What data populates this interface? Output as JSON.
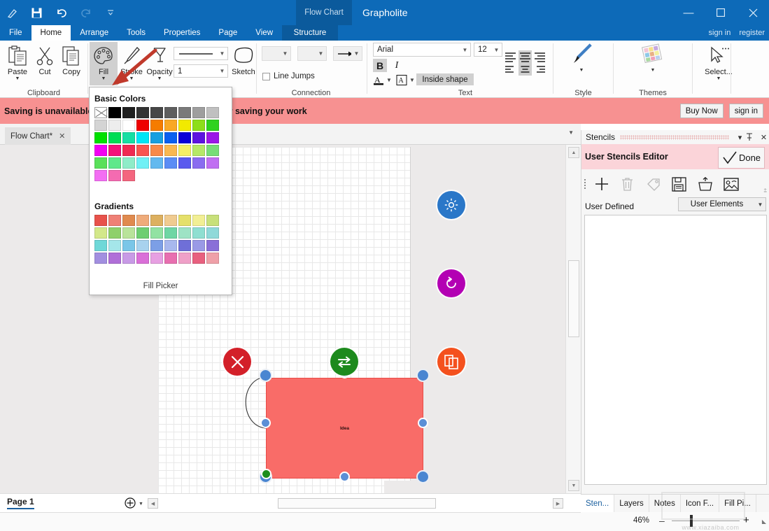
{
  "titlebar": {
    "app_title": "Grapholite",
    "context_tab": "Flow Chart",
    "quick_access": [
      {
        "name": "pen-icon",
        "glyph": "✎"
      },
      {
        "name": "save-icon",
        "glyph": "🖫"
      },
      {
        "name": "undo-icon",
        "glyph": "↶"
      },
      {
        "name": "redo-icon",
        "glyph": "↷"
      },
      {
        "name": "more-icon",
        "glyph": "⩔"
      }
    ],
    "window_controls": [
      {
        "name": "minimize-button",
        "glyph": "—"
      },
      {
        "name": "maximize-button",
        "glyph": "☐"
      },
      {
        "name": "close-button",
        "glyph": "✕"
      }
    ]
  },
  "ribbon_tabs": {
    "items": [
      "File",
      "Home",
      "Arrange",
      "Tools",
      "Properties",
      "Page",
      "View"
    ],
    "active": "Home",
    "context": "Structure",
    "sign_in": "sign in",
    "register": "register"
  },
  "ribbon": {
    "clipboard": {
      "group_label": "Clipboard",
      "paste": "Paste",
      "cut": "Cut",
      "copy": "Copy"
    },
    "style_tools": {
      "fill": "Fill",
      "stroke": "Stroke",
      "opacity": "Opacity",
      "sketch": "Sketch",
      "line_style_value": "",
      "line_width_value": "1"
    },
    "connection": {
      "group_label": "Connection",
      "line_jumps": "Line Jumps",
      "start_arrow_value": "",
      "mid_value": "",
      "end_arrow_value": "→"
    },
    "text": {
      "group_label": "Text",
      "font_family": "Arial",
      "font_size": "12",
      "bold": "B",
      "italic": "I",
      "font_color": "A",
      "highlight_color": "A",
      "text_position": "Inside shape"
    },
    "style": {
      "group_label": "Style"
    },
    "themes": {
      "group_label": "Themes"
    },
    "select": {
      "label": "Select..."
    }
  },
  "warning": {
    "message": "Saving is unavailable in trial version. Install full app for saving your work",
    "buy_now": "Buy Now",
    "sign_in": "sign in"
  },
  "doc_tabs": {
    "items": [
      {
        "label": "Flow Chart*",
        "close": "✕"
      }
    ]
  },
  "fill_panel": {
    "basic_colors_label": "Basic Colors",
    "gradients_label": "Gradients",
    "fill_picker_label": "Fill Picker",
    "basic_colors": [
      [
        "none",
        "#000000",
        "#1f1f1f",
        "#333333",
        "#474747",
        "#5e5e5e",
        "#7a7a7a",
        "#9e9e9e",
        "#c0c0c0"
      ],
      [
        "#d4d4d4",
        "#ededed",
        "#ffffff",
        "#ee0000",
        "#f57c00",
        "#f9a825",
        "#f2ea00",
        "#8ede1a",
        "#2fd21f"
      ],
      [
        "#00e000",
        "#00dd55",
        "#16dfa3",
        "#00e5f5",
        "#189fe0",
        "#0a5ff0",
        "#0a00d8",
        "#5c14e0",
        "#9b17e8"
      ],
      [
        "#f200f2",
        "#f4127b",
        "#f02a52",
        "#f9544f",
        "#f78a4a",
        "#fab851",
        "#f5ef66",
        "#b6e868",
        "#77dd77"
      ],
      [
        "#5ae05a",
        "#5fe88b",
        "#8fecc8",
        "#6ff0f5",
        "#63b9ef",
        "#5b8df5",
        "#5a5aee",
        "#8a6cf0",
        "#c06ff2"
      ],
      [
        "#f36ef3",
        "#f46bb1",
        "#f4667f"
      ]
    ],
    "gradients": [
      [
        "#e8524b",
        "#ef8076",
        "#e08a4e",
        "#efab7a",
        "#ddb05f",
        "#f0cb90",
        "#e5e06a",
        "#f2ef94",
        "#c8e07a"
      ],
      [
        "#d3e88a",
        "#8fd06a",
        "#b9e39a",
        "#6ece71",
        "#92e2a2",
        "#6fd6a4",
        "#9ee3c5",
        "#8fdfd1",
        "#8fd9d9"
      ],
      [
        "#6fd8d8",
        "#a5e6ea",
        "#7ac6e8",
        "#a8d2ee",
        "#7c9fe6",
        "#a8b8ee",
        "#6f6fd8",
        "#9a9ae6",
        "#8a6fd8"
      ],
      [
        "#a28fe0",
        "#b06fd8",
        "#c89ae6",
        "#da6fd8",
        "#e7a0e2",
        "#e86fb0",
        "#efa0c8",
        "#e8607f",
        "#efa0a8"
      ]
    ]
  },
  "canvas": {
    "shape_label": "Idea",
    "action_buttons": [
      {
        "name": "settings-action",
        "icon": "gear-icon"
      },
      {
        "name": "rotate-action",
        "icon": "rotate-icon"
      },
      {
        "name": "duplicate-action",
        "icon": "duplicate-icon"
      },
      {
        "name": "delete-action",
        "icon": "close-icon"
      },
      {
        "name": "swap-action",
        "icon": "swap-icon"
      }
    ]
  },
  "page_bar": {
    "page_label": "Page 1",
    "add_page": "+"
  },
  "dock": {
    "header_title": "Stencils",
    "header_icons": [
      {
        "name": "chevron-down-icon",
        "glyph": "▾"
      },
      {
        "name": "pin-icon",
        "glyph": "⚲"
      },
      {
        "name": "close-icon",
        "glyph": "✕"
      }
    ],
    "editor_title": "User Stencils Editor",
    "done_label": "Done",
    "toolbar_icons": [
      {
        "name": "add-icon"
      },
      {
        "name": "delete-icon"
      },
      {
        "name": "tag-icon"
      },
      {
        "name": "save-icon"
      },
      {
        "name": "open-icon"
      },
      {
        "name": "image-icon"
      }
    ],
    "user_defined_label": "User Defined",
    "user_elements_value": "User Elements",
    "tabs": [
      "Sten...",
      "Layers",
      "Notes",
      "Icon F...",
      "Fill Pi..."
    ],
    "active_tab": "Sten..."
  },
  "status": {
    "zoom_percent": "46%",
    "zoom_minus": "–",
    "zoom_plus": "+"
  },
  "watermark": {
    "text": "www.xiazaiba.com"
  },
  "colors": {
    "title_blue": "#0d6ab8",
    "warning_pink": "#f79191",
    "shape_red": "#f96c68",
    "handle_blue": "#4a86d1",
    "accent_link": "#1a5f9e"
  }
}
